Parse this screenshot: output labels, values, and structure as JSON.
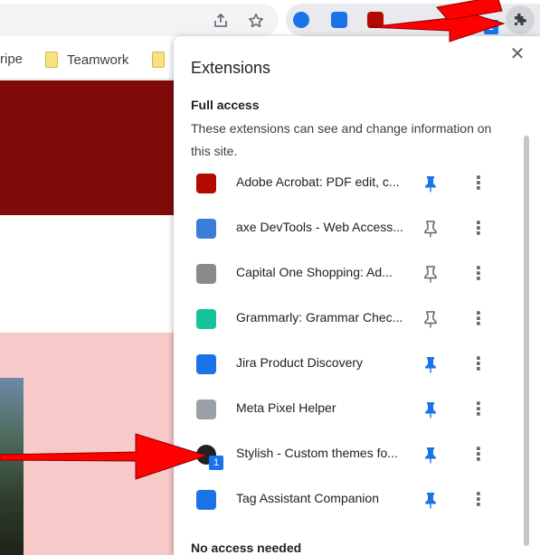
{
  "toolbar": {
    "share_icon": "share-icon",
    "bookmark_star_icon": "star-icon",
    "extensions_button_icon": "puzzle-icon",
    "extension_badge": "1"
  },
  "bookmarks": [
    {
      "label": "ripe",
      "icon": "none"
    },
    {
      "label": "Teamwork",
      "icon": "folder-icon"
    },
    {
      "label": "",
      "icon": "folder-icon"
    }
  ],
  "popup": {
    "title": "Extensions",
    "close_icon": "close-icon",
    "full_access_heading": "Full access",
    "full_access_desc": "These extensions can see and change information on this site.",
    "no_access_heading": "No access needed",
    "extensions": [
      {
        "name": "Adobe Acrobat: PDF edit, c...",
        "pinned": true,
        "icon": "adobe-acrobat-icon",
        "color": "#b30b00"
      },
      {
        "name": "axe DevTools - Web Access...",
        "pinned": false,
        "icon": "axe-devtools-icon",
        "color": "#3b7dd8"
      },
      {
        "name": "Capital One Shopping: Ad...",
        "pinned": false,
        "icon": "capital-one-icon",
        "color": "#8a8a8a"
      },
      {
        "name": "Grammarly: Grammar Chec...",
        "pinned": false,
        "icon": "grammarly-icon",
        "color": "#15c39a"
      },
      {
        "name": "Jira Product Discovery",
        "pinned": true,
        "icon": "jira-icon",
        "color": "#1a73e8"
      },
      {
        "name": "Meta Pixel Helper",
        "pinned": true,
        "icon": "meta-pixel-icon",
        "color": "#9aa0a6"
      },
      {
        "name": "Stylish - Custom themes fo...",
        "pinned": true,
        "icon": "stylish-icon",
        "color": "#202124",
        "badge": "1"
      },
      {
        "name": "Tag Assistant Companion",
        "pinned": true,
        "icon": "tag-assistant-icon",
        "color": "#1a73e8"
      }
    ]
  },
  "colors": {
    "accent": "#1a73e8",
    "hero": "#7f0b0b",
    "pink": "#f7c9c9",
    "arrow": "#ff0000"
  }
}
